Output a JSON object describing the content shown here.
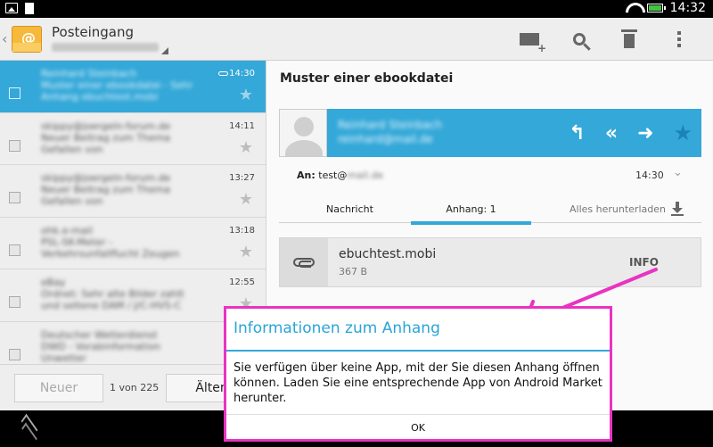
{
  "status_bar": {
    "time": "14:32"
  },
  "action_bar": {
    "title": "Posteingang"
  },
  "list": {
    "rows": [
      {
        "time": "14:30",
        "line1": "Reinhard Steinbach",
        "line2": "Muster einer ebookdatei - Sehr",
        "line3": "Anhang ebuchtest.mobi",
        "selected": true
      },
      {
        "time": "14:11",
        "line1": "skippy@joergeln-forum.de",
        "line2": "Neuer Beitrag zum Thema",
        "line3": "Gefallen von"
      },
      {
        "time": "13:27",
        "line1": "skippy@joergeln-forum.de",
        "line2": "Neuer Beitrag zum Thema",
        "line3": "Gefallen von"
      },
      {
        "time": "13:18",
        "line1": "ohk.e-mail",
        "line2": "PSL-SK-Meter -",
        "line3": "Verkehrsunfallflucht Zeugen"
      },
      {
        "time": "12:55",
        "line1": "eBay",
        "line2": "Ordnet: Sehr alte Bilder zahlt",
        "line3": "und seltene DAM / J/C-HVS-C"
      },
      {
        "time": "",
        "line1": "Deutscher Wetterdienst",
        "line2": "DWD - Vorabinformation",
        "line3": "Unwetter"
      }
    ],
    "footer": {
      "newer_label": "Neuer",
      "pager": "1 von 225",
      "older_label": "Älter"
    }
  },
  "detail": {
    "subject": "Muster einer ebookdatei",
    "sender_name": "Reinhard Steinbach",
    "sender_email": "reinhard@mail.de",
    "to_label": "An:",
    "to_value": "test@",
    "to_blur": "mail.de",
    "time": "14:30",
    "tabs": {
      "message": "Nachricht",
      "attachments": "Anhang: 1",
      "download_all": "Alles herunterladen"
    },
    "attachment": {
      "name": "ebuchtest.mobi",
      "size": "367 B",
      "info_label": "INFO"
    }
  },
  "dialog": {
    "title": "Informationen zum Anhang",
    "body": "Sie verfügen über keine App, mit der Sie diesen Anhang öffnen können. Laden Sie eine entsprechende App von Android Market herunter.",
    "ok_label": "OK"
  },
  "colors": {
    "accent": "#34a8d8",
    "highlight": "#e933c1"
  },
  "icons": {
    "compose": "compose-icon",
    "search": "search-icon",
    "delete": "trash-icon",
    "overflow": "overflow-menu-icon",
    "reply": "reply-icon",
    "reply_all": "reply-all-icon",
    "forward": "forward-icon",
    "star": "star-icon",
    "attachment": "paperclip-icon",
    "download": "download-icon"
  }
}
